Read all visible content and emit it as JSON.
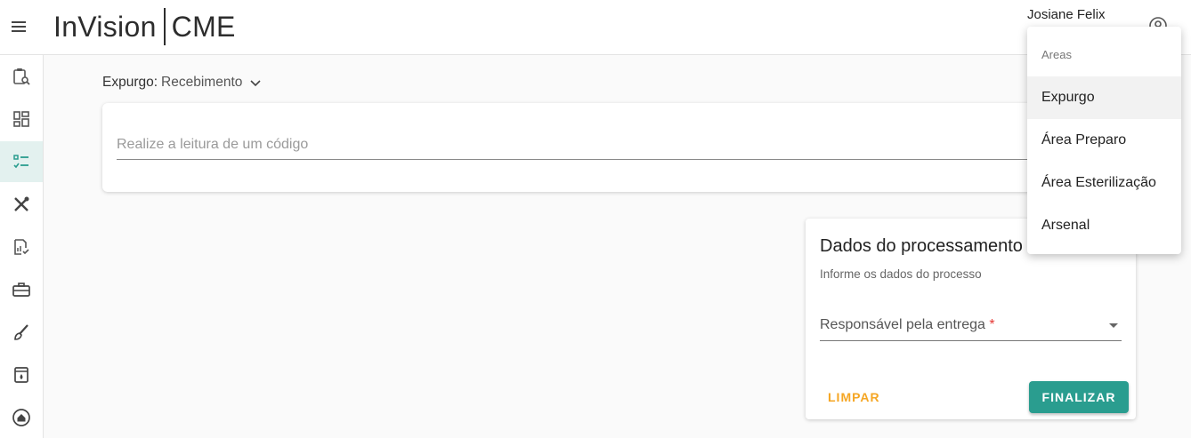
{
  "header": {
    "brand_left": "InVision",
    "brand_right": "CME",
    "user_name": "Josiane Felix",
    "icons": {
      "menu": "hamburger-menu-icon",
      "user": "user-circle-icon"
    }
  },
  "sidebar": {
    "items": [
      {
        "icon": "clipboard-search-icon",
        "active": false
      },
      {
        "icon": "dashboard-grid-icon",
        "active": false
      },
      {
        "icon": "checklist-icon",
        "active": true
      },
      {
        "icon": "tools-icon",
        "active": false
      },
      {
        "icon": "report-check-icon",
        "active": false
      },
      {
        "icon": "toolbox-icon",
        "active": false
      },
      {
        "icon": "brush-icon",
        "active": false
      },
      {
        "icon": "sterilizer-icon",
        "active": false
      },
      {
        "icon": "home-icon",
        "active": false
      }
    ]
  },
  "breadcrumb": {
    "area": "Expurgo:",
    "step": "Recebimento"
  },
  "scan": {
    "placeholder": "Realize a leitura de um código"
  },
  "process_card": {
    "title": "Dados do processamento",
    "subtitle": "Informe os dados do processo",
    "responsible_label": "Responsável pela entrega",
    "required_mark": "*",
    "clear_button": "LIMPAR",
    "finish_button": "FINALIZAR"
  },
  "areas_menu": {
    "header": "Areas",
    "items": [
      "Expurgo",
      "Área Preparo",
      "Área Esterilização",
      "Arsenal"
    ]
  },
  "colors": {
    "accent": "#2a9d8f",
    "clear_text": "#f5a623",
    "required": "#e53935",
    "active_sidebar_bg": "#e3f1ef"
  }
}
